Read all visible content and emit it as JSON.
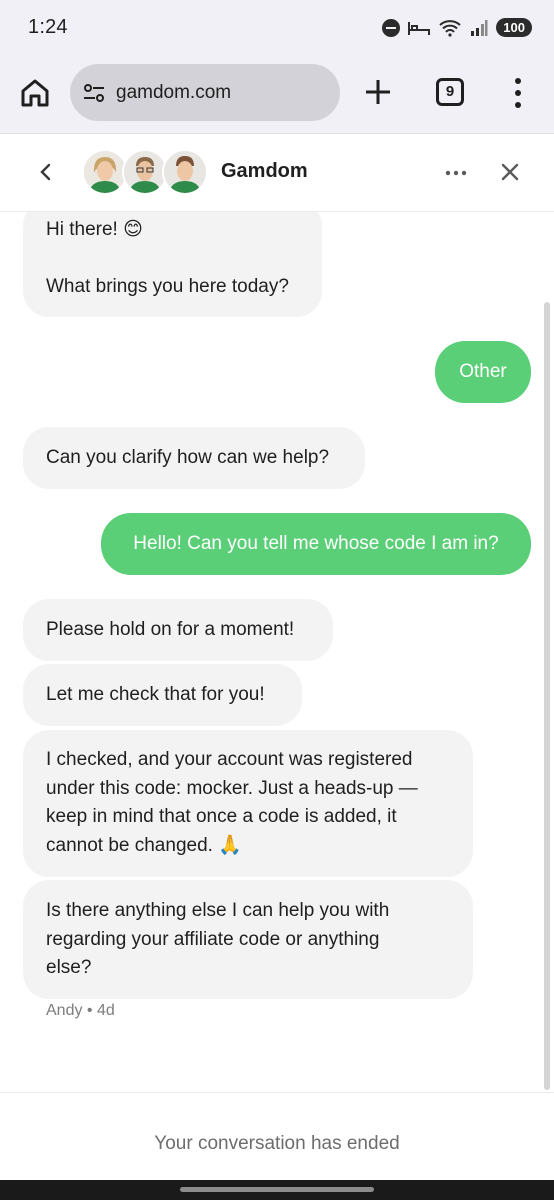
{
  "status": {
    "time": "1:24",
    "battery": "100"
  },
  "browser": {
    "url": "gamdom.com",
    "tab_count": "9"
  },
  "chat": {
    "title": "Gamdom",
    "agent_name_meta": "Andy • 4d",
    "ended_text": "Your conversation has ended"
  },
  "messages": [
    {
      "sender": "agent",
      "lines": [
        "Hi there! 😊",
        "",
        "What brings you here today?"
      ]
    },
    {
      "sender": "user",
      "lines": [
        "Other"
      ]
    },
    {
      "sender": "agent",
      "lines": [
        "Can you clarify how can we help?"
      ]
    },
    {
      "sender": "user",
      "lines": [
        "Hello! Can you tell me whose code I am in?"
      ]
    },
    {
      "sender": "agent",
      "lines": [
        "Please hold on for a moment!"
      ]
    },
    {
      "sender": "agent",
      "lines": [
        "Let me check that for you!"
      ]
    },
    {
      "sender": "agent",
      "lines": [
        "I checked, and your account was registered",
        "under this code: mocker. Just a heads-up —",
        "keep in mind that once a code is added, it",
        "cannot be changed. 🙏"
      ]
    },
    {
      "sender": "agent",
      "lines": [
        "Is there anything else I can help you with",
        "regarding your affiliate code or anything",
        "else?"
      ]
    }
  ],
  "colors": {
    "user_bubble": "#5bcf77",
    "agent_bubble": "#f3f3f3",
    "chrome_bg": "#f1f0f6"
  }
}
